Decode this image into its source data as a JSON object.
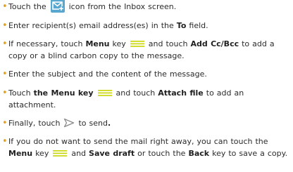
{
  "bullet": "•",
  "icons": {
    "compose": "compose-mail-icon",
    "menu": "menu-key-icon",
    "send": "send-arrow-icon"
  },
  "colors": {
    "bullet": "#e6a21e",
    "menu_icon": "#c7d400",
    "compose_icon_bg": "#59a6ce",
    "send_icon": "#8a8a8a"
  },
  "items": [
    {
      "a": "Touch the ",
      "b": " icon from the Inbox screen."
    },
    {
      "a": "Enter recipient(s) email address(es) in the ",
      "bold1": "To",
      "b": " field."
    },
    {
      "a": "If necessary, touch ",
      "bold1": "Menu",
      "b": " key ",
      "c": " and touch ",
      "bold2": "Add Cc/Bcc",
      "d": " to add a copy or a blind carbon copy to the message."
    },
    {
      "a": "Enter the subject and the content of the message."
    },
    {
      "a": "Touch ",
      "bold1": "the Menu key",
      "b": " ",
      "c": " and touch ",
      "bold2": "Attach file",
      "d": " to add an attachment."
    },
    {
      "a": "Finally, touch ",
      "b": " to send",
      "bold1": "."
    },
    {
      "a": "If you do not want to send the mail right away, you can touch the ",
      "bold1": "Menu",
      "b": " key ",
      "c": " and ",
      "bold2": "Save draft",
      "d": " or touch the ",
      "bold3": "Back",
      "e": " key to save a copy."
    }
  ]
}
